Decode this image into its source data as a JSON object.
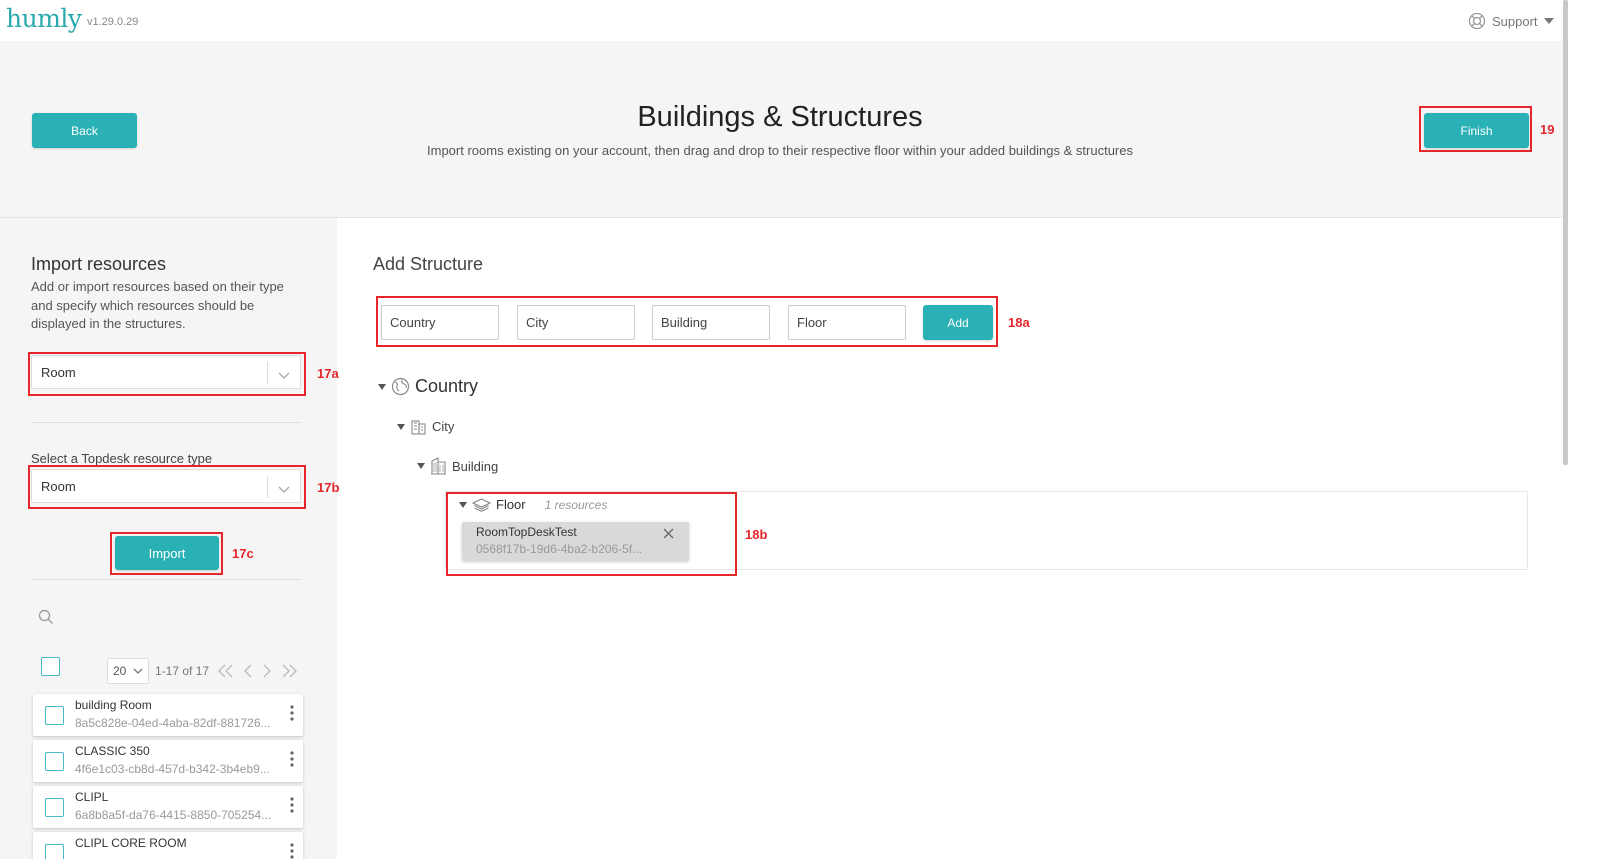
{
  "app": {
    "logo_text": "humly",
    "version": "v1.29.0.29",
    "support_label": "Support"
  },
  "header": {
    "back_label": "Back",
    "title": "Buildings & Structures",
    "subtitle": "Import rooms existing on your account, then drag and drop to their respective floor within your added buildings & structures",
    "finish_label": "Finish"
  },
  "import_panel": {
    "title": "Import resources",
    "description": "Add or import resources based on their type and specify which resources should be displayed in the structures.",
    "resource_type_value": "Room",
    "topdesk_label": "Select a Topdesk resource type",
    "topdesk_type_value": "Room",
    "import_label": "Import",
    "page_size": "20",
    "page_range": "1-17 of 17",
    "resources": [
      {
        "name": "building Room",
        "id": "8a5c828e-04ed-4aba-82df-881726..."
      },
      {
        "name": "CLASSIC 350",
        "id": "4f6e1c03-cb8d-457d-b342-3b4eb9..."
      },
      {
        "name": "CLIPL",
        "id": "6a8b8a5f-da76-4415-8850-705254..."
      },
      {
        "name": "CLIPL CORE ROOM",
        "id": ""
      }
    ]
  },
  "structure_panel": {
    "title": "Add Structure",
    "inputs": {
      "country_placeholder": "Country",
      "city_placeholder": "City",
      "building_placeholder": "Building",
      "floor_placeholder": "Floor"
    },
    "add_label": "Add",
    "tree": {
      "country": "Country",
      "city": "City",
      "building": "Building",
      "floor": "Floor",
      "floor_count": "1 resources",
      "room_name": "RoomTopDeskTest",
      "room_id": "0568f17b-19d6-4ba2-b206-5f..."
    }
  },
  "annotations": {
    "a17a": "17a",
    "a17b": "17b",
    "a17c": "17c",
    "a18a": "18a",
    "a18b": "18b",
    "a19": "19"
  },
  "colors": {
    "accent": "#29b1b5",
    "annotation": "#e5262b",
    "panel_bg": "#f5f5f5"
  },
  "icons": [
    "support-lifebuoy-icon",
    "chevron-down-icon",
    "search-icon",
    "globe-icon",
    "city-icon",
    "building-icon",
    "layers-icon",
    "close-icon",
    "more-vertical-icon",
    "first-page-icon",
    "prev-page-icon",
    "next-page-icon",
    "last-page-icon"
  ]
}
